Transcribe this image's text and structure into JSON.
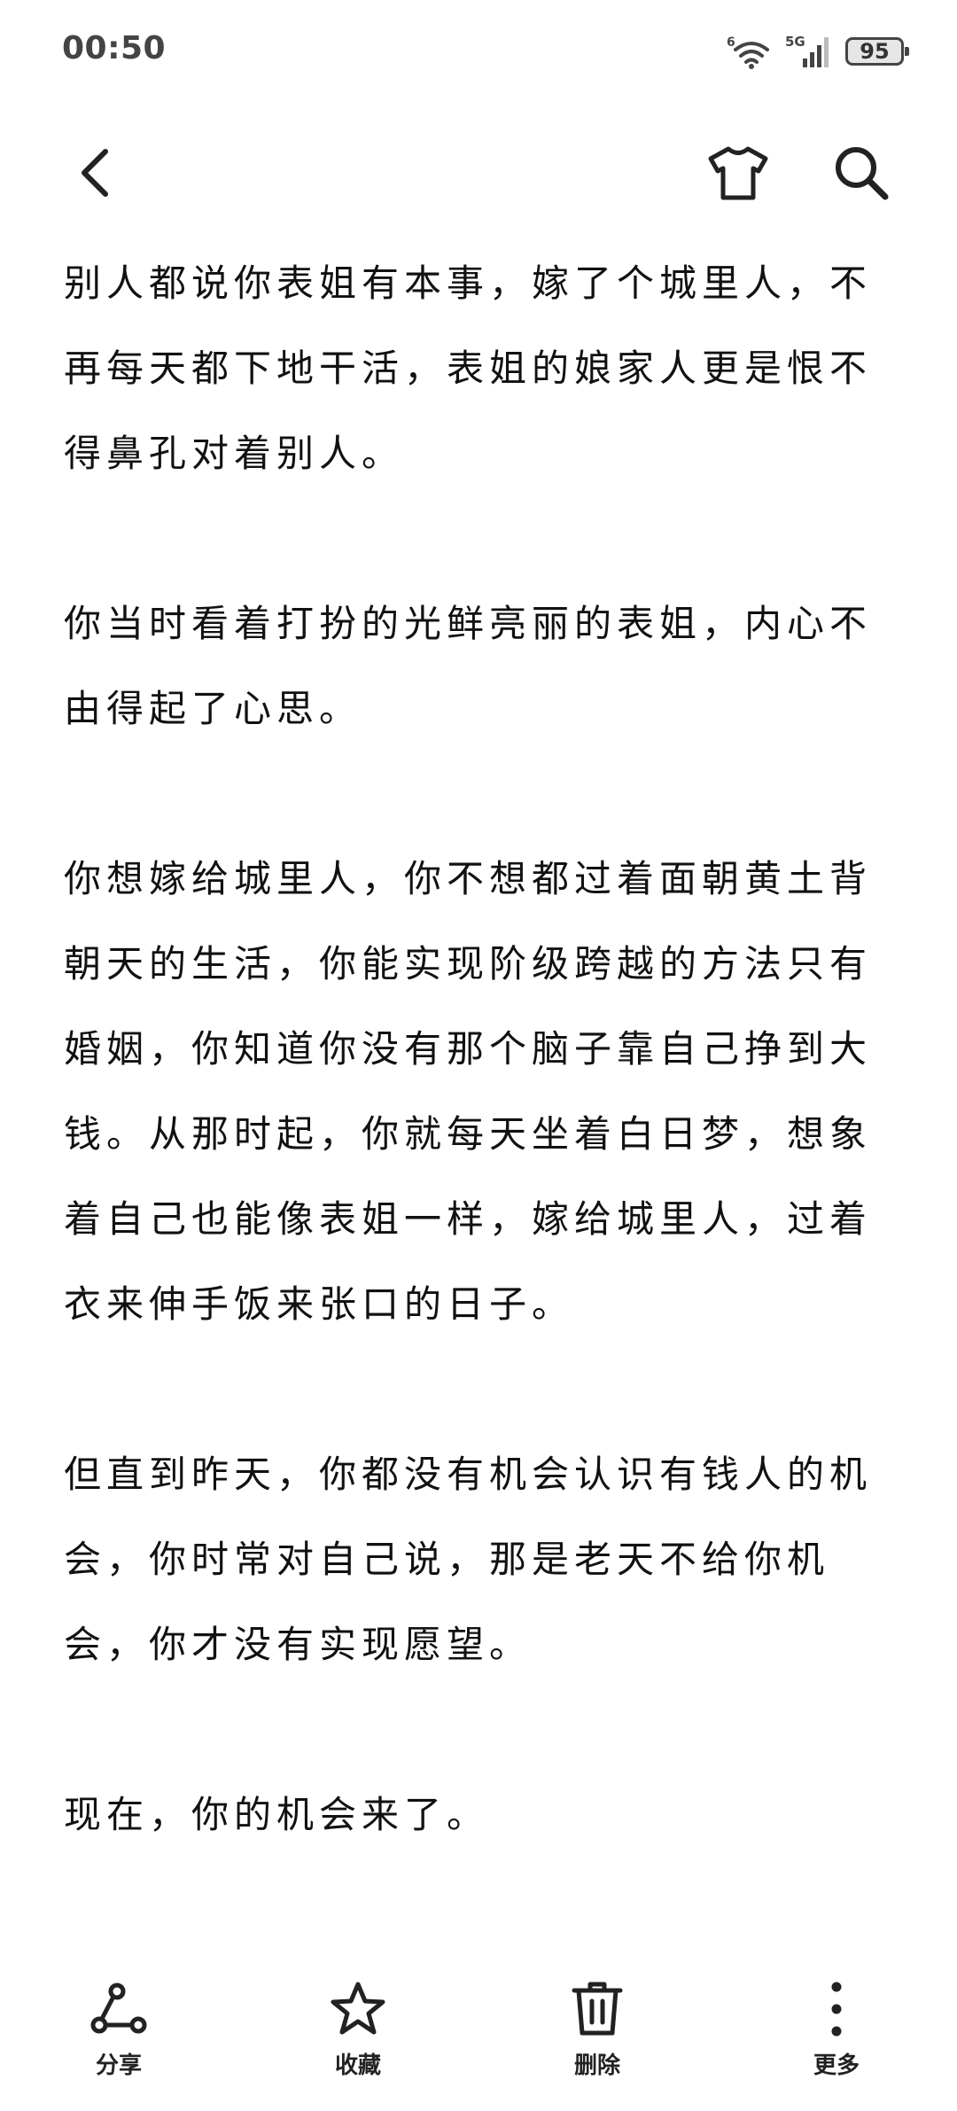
{
  "status_bar": {
    "time": "00:50",
    "network_label": "5G",
    "wifi_label": "6",
    "battery": "95"
  },
  "content": {
    "paragraphs": [
      "别人都说你表姐有本事，嫁了个城里人，不再每天都下地干活，表姐的娘家人更是恨不得鼻孔对着别人。",
      "你当时看着打扮的光鲜亮丽的表姐，内心不由得起了心思。",
      "你想嫁给城里人，你不想都过着面朝黄土背朝天的生活，你能实现阶级跨越的方法只有婚姻，你知道你没有那个脑子靠自己挣到大钱。从那时起，你就每天坐着白日梦，想象着自己也能像表姐一样，嫁给城里人，过着衣来伸手饭来张口的日子。",
      "但直到昨天，你都没有机会认识有钱人的机会，你时常对自己说，那是老天不给你机会，你才没有实现愿望。",
      "现在，你的机会来了。"
    ]
  },
  "toolbar": {
    "share_label": "分享",
    "favorite_label": "收藏",
    "delete_label": "删除",
    "more_label": "更多"
  },
  "icons": {
    "back": "chevron-left-icon",
    "theme": "tshirt-icon",
    "search": "search-icon",
    "share": "share-icon",
    "favorite": "star-icon",
    "delete": "trash-icon",
    "more": "more-vertical-icon"
  },
  "colors": {
    "text": "#111111",
    "status_text": "#444444",
    "background": "#ffffff"
  }
}
